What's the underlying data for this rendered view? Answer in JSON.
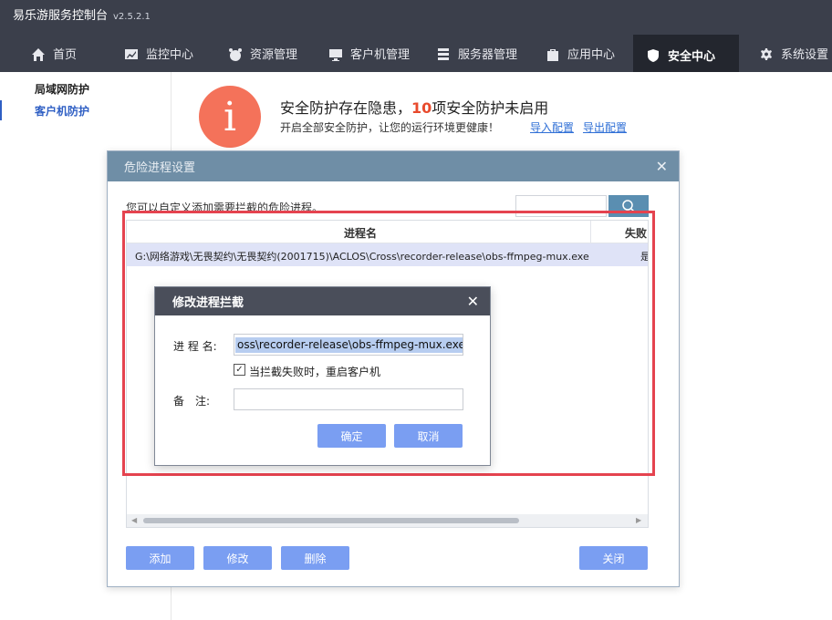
{
  "app": {
    "title": "易乐游服务控制台",
    "version": "v2.5.2.1"
  },
  "nav": [
    {
      "label": "首页",
      "icon": "home-icon"
    },
    {
      "label": "监控中心",
      "icon": "monitor-chart-icon"
    },
    {
      "label": "资源管理",
      "icon": "resource-icon"
    },
    {
      "label": "客户机管理",
      "icon": "client-computer-icon"
    },
    {
      "label": "服务器管理",
      "icon": "server-icon"
    },
    {
      "label": "应用中心",
      "icon": "app-store-icon"
    },
    {
      "label": "安全中心",
      "icon": "shield-icon",
      "active": true
    },
    {
      "label": "系统设置",
      "icon": "gear-icon"
    }
  ],
  "sidebar": {
    "items": [
      {
        "label": "局域网防护"
      },
      {
        "label": "客户机防护"
      }
    ]
  },
  "alert": {
    "title_prefix": "安全防护存在隐患，",
    "count": "10",
    "title_suffix": "项安全防护未启用",
    "subtitle": "开启全部安全防护，让您的运行环境更健康！",
    "import_link": "导入配置",
    "export_link": "导出配置",
    "icon_glyph": "i"
  },
  "process_dialog": {
    "title": "危险进程设置",
    "description": "您可以自定义添加需要拦截的危险进程。",
    "search_value": "",
    "columns": [
      "进程名",
      "失败"
    ],
    "rows": [
      {
        "name": "G:\\网络游戏\\无畏契约\\无畏契约(2001715)\\ACLOS\\Cross\\recorder-release\\obs-ffmpeg-mux.exe",
        "fail": "是"
      }
    ],
    "buttons": {
      "add": "添加",
      "modify": "修改",
      "delete": "删除",
      "close": "关闭"
    }
  },
  "modify_dialog": {
    "title": "修改进程拦截",
    "process_label": "进 程 名:",
    "process_value": "oss\\recorder-release\\obs-ffmpeg-mux.exe",
    "checkbox_label": "当拦截失败时，重启客户机",
    "checkbox_checked": true,
    "remark_label": "备　注:",
    "remark_value": "",
    "ok": "确定",
    "cancel": "取消"
  },
  "colors": {
    "accent": "#7a9ef2",
    "danger": "#e5434f",
    "alert_icon": "#f4725a",
    "topbar": "#3b3f4b"
  }
}
